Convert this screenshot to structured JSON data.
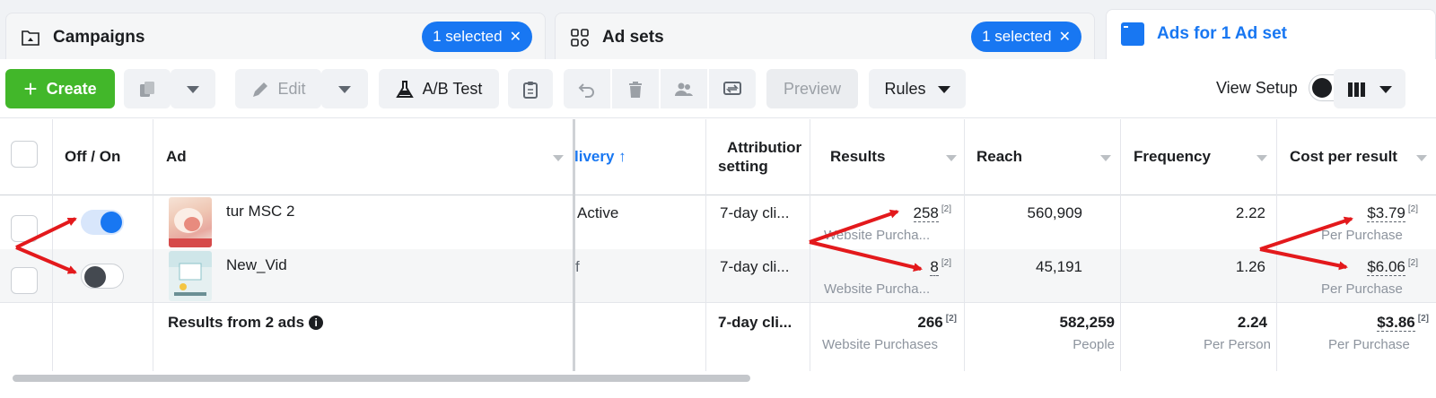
{
  "tabs": {
    "campaigns": {
      "label": "Campaigns",
      "selected_badge": "1 selected"
    },
    "adsets": {
      "label": "Ad sets",
      "selected_badge": "1 selected"
    },
    "ads": {
      "label": "Ads for 1 Ad set"
    }
  },
  "toolbar": {
    "create_label": "Create",
    "edit_label": "Edit",
    "ab_test_label": "A/B Test",
    "preview_label": "Preview",
    "rules_label": "Rules",
    "view_setup_label": "View Setup"
  },
  "table": {
    "headers": {
      "toggle": "Off / On",
      "ad": "Ad",
      "delivery": "livery ↑",
      "attribution_line1": "Attributior",
      "attribution_line2": "setting",
      "results": "Results",
      "reach": "Reach",
      "frequency": "Frequency",
      "cost_per_result": "Cost per result"
    },
    "rows": [
      {
        "name": "tur MSC 2",
        "enabled": true,
        "delivery": "Active",
        "attribution": "7-day cli...",
        "results": "258",
        "results_note": "[2]",
        "results_sub": "Website Purcha...",
        "reach": "560,909",
        "frequency": "2.22",
        "cost": "$3.79",
        "cost_note": "[2]",
        "cost_sub": "Per Purchase"
      },
      {
        "name": "New_Vid",
        "enabled": false,
        "delivery": "f",
        "attribution": "7-day cli...",
        "results": "8",
        "results_note": "[2]",
        "results_sub": "Website Purcha...",
        "reach": "45,191",
        "frequency": "1.26",
        "cost": "$6.06",
        "cost_note": "[2]",
        "cost_sub": "Per Purchase"
      }
    ],
    "summary": {
      "label": "Results from 2 ads",
      "attribution": "7-day cli...",
      "results": "266",
      "results_note": "[2]",
      "results_sub": "Website Purchases",
      "reach": "582,259",
      "reach_sub": "People",
      "frequency": "2.24",
      "frequency_sub": "Per Person",
      "cost": "$3.86",
      "cost_note": "[2]",
      "cost_sub": "Per Purchase"
    }
  },
  "colors": {
    "accent": "#1877f2",
    "create_green": "#42b72a",
    "annotation_red": "#e3191c"
  },
  "icons": [
    "folder-icon",
    "grid-icon",
    "ad-tab-icon",
    "plus-icon",
    "duplicate-icon",
    "pencil-icon",
    "flask-icon",
    "clipboard-icon",
    "undo-icon",
    "trash-icon",
    "people-icon",
    "preview-swap-icon",
    "columns-icon",
    "info-icon"
  ]
}
